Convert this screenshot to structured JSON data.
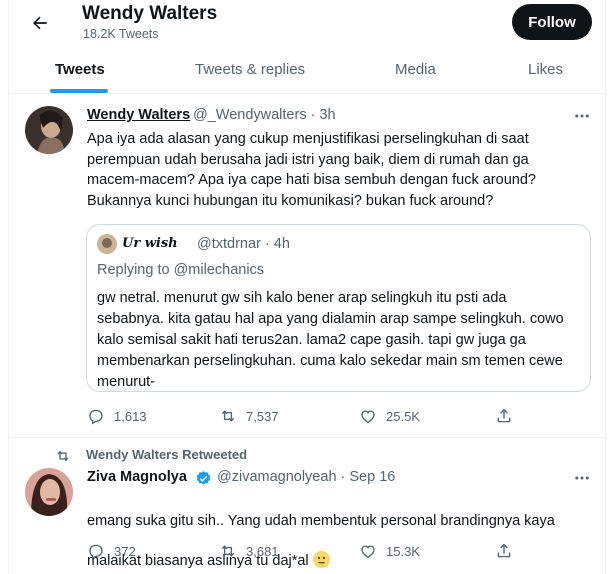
{
  "header": {
    "name": "Wendy Walters",
    "tweet_count": "18.2K Tweets",
    "follow_label": "Follow"
  },
  "tabs": [
    {
      "label": "Tweets",
      "active": true
    },
    {
      "label": "Tweets & replies",
      "active": false
    },
    {
      "label": "Media",
      "active": false
    },
    {
      "label": "Likes",
      "active": false
    }
  ],
  "tweet1": {
    "name": "Wendy Walters",
    "meta": "@_Wendywalters · 3h",
    "text": "Apa iya ada alasan yang cukup menjustifikasi perselingkuhan di saat\nperempuan udah berusaha jadi istri yang baik, diem di rumah dan ga\nmacem-macem? Apa iya cape hati bisa sembuh dengan fuck around?\nBukannya kunci hubungan itu komunikasi? bukan fuck around?",
    "quote": {
      "name": "Ur wish",
      "meta": "@txtdrnar · 4h",
      "replying": "Replying to @milechanics",
      "text": "gw netral. menurut gw sih kalo bener arap selingkuh itu psti ada\nsebabnya. kita gatau hal apa yang dialamin arap sampe selingkuh. cowo\nkalo semisal sakit hati terus2an. lama2 cape gasih. tapi gw juga ga\nmembenarkan perselingkuhan. cuma kalo sekedar main sm temen cewe\nmenurut-"
    },
    "replies": "1,613",
    "retweets": "7,537",
    "likes": "25.5K"
  },
  "tweet2": {
    "retweeted_by": "Wendy Walters Retweeted",
    "name": "Ziva Magnolya",
    "meta": "@zivamagnolyeah · Sep 16",
    "text_line1": "emang suka gitu sih.. Yang udah membentuk personal brandingnya kaya",
    "text_line2": "malaikat biasanya aslinya tu daj*al",
    "replies": "372",
    "retweets": "3,681",
    "likes": "15.3K"
  },
  "colors": {
    "accent": "#1d9bf0",
    "text": "#0f1419",
    "secondary": "#536471",
    "border": "#eff3f4"
  },
  "icons": [
    "back-arrow-icon",
    "more-icon",
    "reply-icon",
    "retweet-icon",
    "like-icon",
    "share-icon",
    "verified-badge-icon",
    "neutral-face-emoji"
  ]
}
